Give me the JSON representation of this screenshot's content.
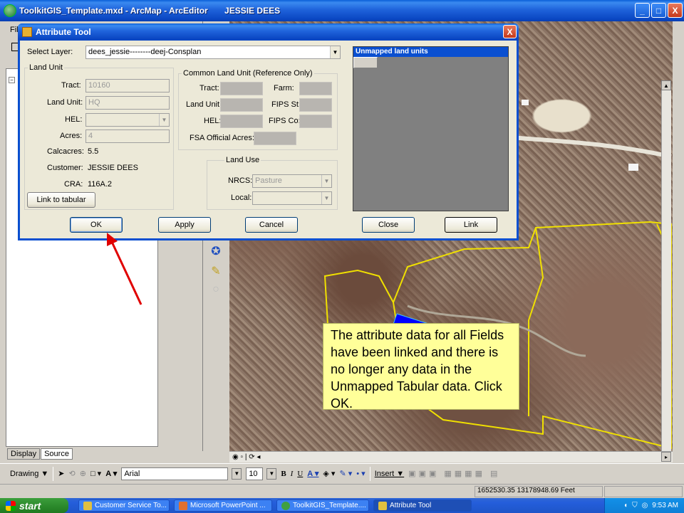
{
  "window": {
    "title": "ToolkitGIS_Template.mxd - ArcMap - ArcEditor       JESSIE DEES",
    "minimize": "_",
    "maximize": "□",
    "close": "X"
  },
  "left_panel": {
    "menu_glyph": "Fil",
    "expander": "−",
    "tabs": [
      "Display",
      "Source"
    ]
  },
  "dialog": {
    "title": "Attribute Tool",
    "close": "X",
    "select_layer_label": "Select Layer:",
    "select_layer_value": "dees_jessie--------deej-Consplan",
    "land_unit_group": "Land Unit",
    "tract_label": "Tract:",
    "tract_value": "10160",
    "land_unit_label": "Land Unit:",
    "land_unit_value": "HQ",
    "hel_label": "HEL:",
    "hel_value": "",
    "acres_label": "Acres:",
    "acres_value": "4",
    "calcacres_label": "Calcacres:",
    "calcacres_value": "5.5",
    "customer_label": "Customer:",
    "customer_value": "JESSIE DEES",
    "cra_label": "CRA:",
    "cra_value": "116A.2",
    "link_tabular": "Link to tabular",
    "clu_group": "Common Land Unit (Reference Only)",
    "clu_tract_label": "Tract:",
    "clu_farm_label": "Farm:",
    "clu_land_unit_label": "Land Unit:",
    "clu_fips_st_label": "FIPS St:",
    "clu_hel_label": "HEL:",
    "clu_fips_co_label": "FIPS Co:",
    "clu_fsa_acres_label": "FSA Official Acres:",
    "land_use_group": "Land Use",
    "nrcs_label": "NRCS:",
    "nrcs_value": "Pasture",
    "local_label": "Local:",
    "local_value": "",
    "unmapped_header": "Unmapped land units",
    "buttons": {
      "ok": "OK",
      "apply": "Apply",
      "cancel": "Cancel",
      "close": "Close",
      "link": "Link"
    }
  },
  "callout": {
    "text": "The attribute data for all Fields have been linked and there is no longer any data in the Unmapped Tabular data. Click OK."
  },
  "draw_toolbar": {
    "drawing": "Drawing ▼",
    "font": "Arial",
    "size": "10",
    "bold": "B",
    "italic": "I",
    "underline": "U",
    "insert": "Insert ▼"
  },
  "status_bar": {
    "coordinates": "1652530.35  13178948.69 Feet"
  },
  "taskbar": {
    "start": "start",
    "items": [
      "Customer Service To...",
      "Microsoft PowerPoint ...",
      "ToolkitGIS_Template....",
      "Attribute Tool"
    ],
    "clock": "9:53 AM"
  },
  "colors": {
    "xp_blue": "#0a4fd0",
    "callout_fill": "#ffff99",
    "polygon_outline": "#f0e000",
    "selected_polygon": "#0000ff",
    "arrow": "#e00000"
  }
}
